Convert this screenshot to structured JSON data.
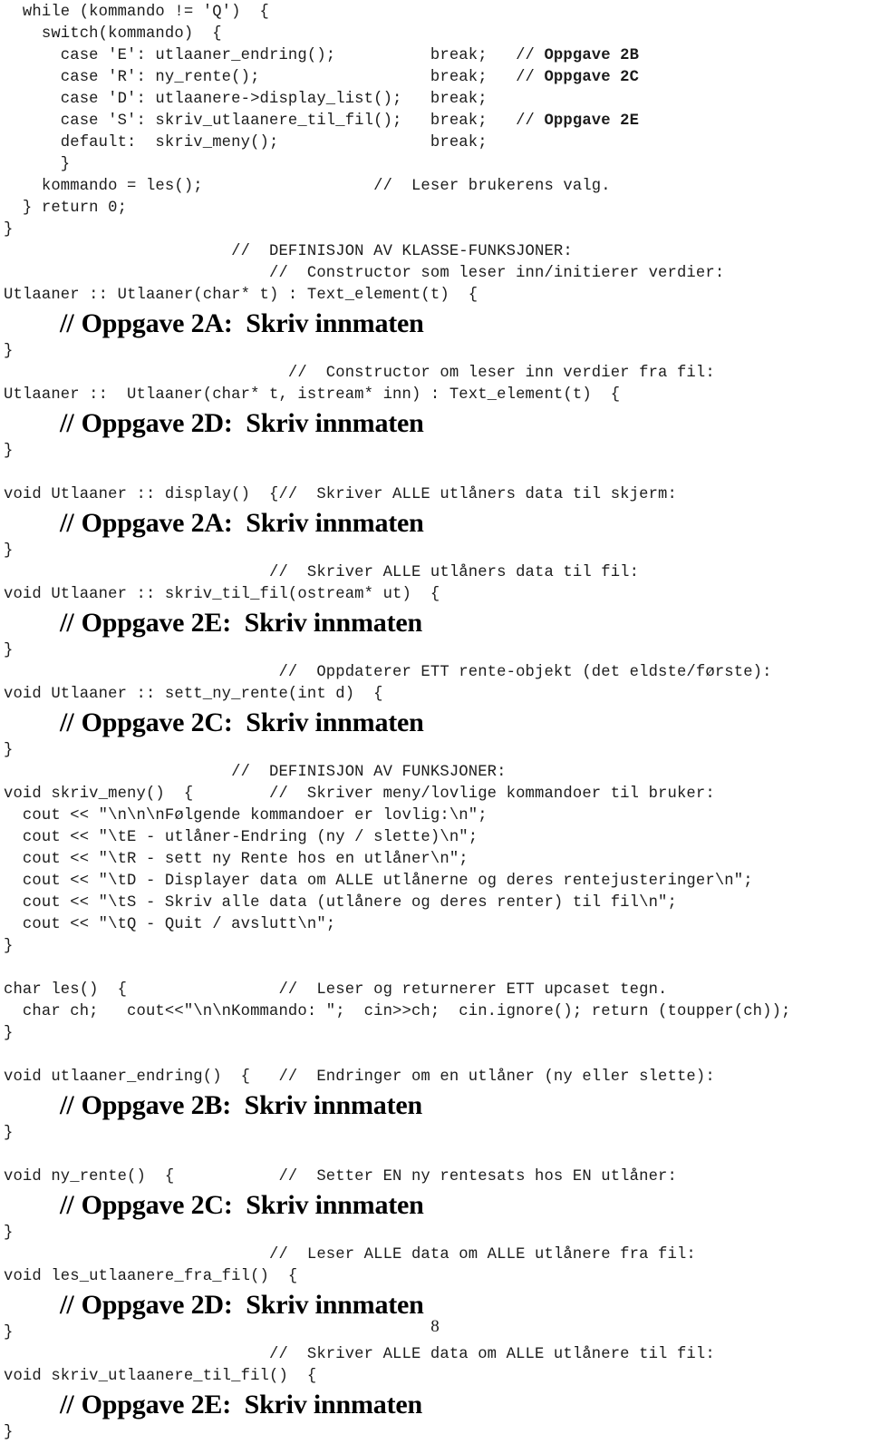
{
  "document": {
    "page_number": "8",
    "language": "C++",
    "kind": "source-code-listing"
  },
  "lines": [
    {
      "type": "code",
      "text": "  while (kommando != 'Q')  {"
    },
    {
      "type": "code",
      "text": "    switch(kommando)  {"
    },
    {
      "type": "code_bold_tail",
      "text": "      case 'E': utlaaner_endring();          break;   // ",
      "bold": "Oppgave 2B"
    },
    {
      "type": "code_bold_tail",
      "text": "      case 'R': ny_rente();                  break;   // ",
      "bold": "Oppgave 2C"
    },
    {
      "type": "code",
      "text": "      case 'D': utlaanere->display_list();   break;"
    },
    {
      "type": "code_bold_tail",
      "text": "      case 'S': skriv_utlaanere_til_fil();   break;   // ",
      "bold": "Oppgave 2E"
    },
    {
      "type": "code",
      "text": "      default:  skriv_meny();                break;"
    },
    {
      "type": "code",
      "text": "      }"
    },
    {
      "type": "code",
      "text": "    kommando = les();                  //  Leser brukerens valg."
    },
    {
      "type": "code",
      "text": "  } return 0;"
    },
    {
      "type": "code",
      "text": "}"
    },
    {
      "type": "code",
      "text": "                        //  DEFINISJON AV KLASSE-FUNKSJONER:"
    },
    {
      "type": "code",
      "text": "                            //  Constructor som leser inn/initierer verdier:"
    },
    {
      "type": "code",
      "text": "Utlaaner :: Utlaaner(char* t) : Text_element(t)  {"
    },
    {
      "type": "task",
      "slashes": "//",
      "text": "Oppgave 2A:  Skriv innmaten"
    },
    {
      "type": "code",
      "text": "}"
    },
    {
      "type": "code",
      "text": "                              //  Constructor om leser inn verdier fra fil:"
    },
    {
      "type": "code",
      "text": "Utlaaner ::  Utlaaner(char* t, istream* inn) : Text_element(t)  {"
    },
    {
      "type": "task",
      "slashes": "//",
      "text": "Oppgave 2D:  Skriv innmaten"
    },
    {
      "type": "code",
      "text": "}"
    },
    {
      "type": "blank",
      "text": ""
    },
    {
      "type": "code",
      "text": "void Utlaaner :: display()  {//  Skriver ALLE utlåners data til skjerm:"
    },
    {
      "type": "task",
      "slashes": "//",
      "text": "Oppgave 2A:  Skriv innmaten"
    },
    {
      "type": "code",
      "text": "}"
    },
    {
      "type": "code",
      "text": "                            //  Skriver ALLE utlåners data til fil:"
    },
    {
      "type": "code",
      "text": "void Utlaaner :: skriv_til_fil(ostream* ut)  {"
    },
    {
      "type": "task",
      "slashes": "//",
      "text": "Oppgave 2E:  Skriv innmaten"
    },
    {
      "type": "code",
      "text": "}"
    },
    {
      "type": "code",
      "text": "                             //  Oppdaterer ETT rente-objekt (det eldste/første):"
    },
    {
      "type": "code",
      "text": "void Utlaaner :: sett_ny_rente(int d)  {"
    },
    {
      "type": "task",
      "slashes": "//",
      "text": "Oppgave 2C:  Skriv innmaten"
    },
    {
      "type": "code",
      "text": "}"
    },
    {
      "type": "code",
      "text": "                        //  DEFINISJON AV FUNKSJONER:"
    },
    {
      "type": "code",
      "text": "void skriv_meny()  {        //  Skriver meny/lovlige kommandoer til bruker:"
    },
    {
      "type": "code",
      "text": "  cout << \"\\n\\n\\nFølgende kommandoer er lovlig:\\n\";"
    },
    {
      "type": "code",
      "text": "  cout << \"\\tE - utlåner-Endring (ny / slette)\\n\";"
    },
    {
      "type": "code",
      "text": "  cout << \"\\tR - sett ny Rente hos en utlåner\\n\";"
    },
    {
      "type": "code",
      "text": "  cout << \"\\tD - Displayer data om ALLE utlånerne og deres rentejusteringer\\n\";"
    },
    {
      "type": "code",
      "text": "  cout << \"\\tS - Skriv alle data (utlånere og deres renter) til fil\\n\";"
    },
    {
      "type": "code",
      "text": "  cout << \"\\tQ - Quit / avslutt\\n\";"
    },
    {
      "type": "code",
      "text": "}"
    },
    {
      "type": "blank",
      "text": ""
    },
    {
      "type": "code",
      "text": "char les()  {                //  Leser og returnerer ETT upcaset tegn."
    },
    {
      "type": "code",
      "text": "  char ch;   cout<<\"\\n\\nKommando: \";  cin>>ch;  cin.ignore(); return (toupper(ch));"
    },
    {
      "type": "code",
      "text": "}"
    },
    {
      "type": "blank",
      "text": ""
    },
    {
      "type": "code",
      "text": "void utlaaner_endring()  {   //  Endringer om en utlåner (ny eller slette):"
    },
    {
      "type": "task",
      "slashes": "//",
      "text": "Oppgave 2B:  Skriv innmaten"
    },
    {
      "type": "code",
      "text": "}"
    },
    {
      "type": "blank",
      "text": ""
    },
    {
      "type": "code",
      "text": "void ny_rente()  {           //  Setter EN ny rentesats hos EN utlåner:"
    },
    {
      "type": "task",
      "slashes": "//",
      "text": "Oppgave 2C:  Skriv innmaten"
    },
    {
      "type": "code",
      "text": "}"
    },
    {
      "type": "code",
      "text": "                            //  Leser ALLE data om ALLE utlånere fra fil:"
    },
    {
      "type": "code",
      "text": "void les_utlaanere_fra_fil()  {"
    },
    {
      "type": "task",
      "slashes": "//",
      "text": "Oppgave 2D:  Skriv innmaten"
    },
    {
      "type": "code",
      "text": "}"
    },
    {
      "type": "code",
      "text": "                            //  Skriver ALLE data om ALLE utlånere til fil:"
    },
    {
      "type": "code",
      "text": "void skriv_utlaanere_til_fil()  {"
    },
    {
      "type": "task",
      "slashes": "//",
      "text": "Oppgave 2E:  Skriv innmaten"
    },
    {
      "type": "code",
      "text": "}"
    }
  ]
}
